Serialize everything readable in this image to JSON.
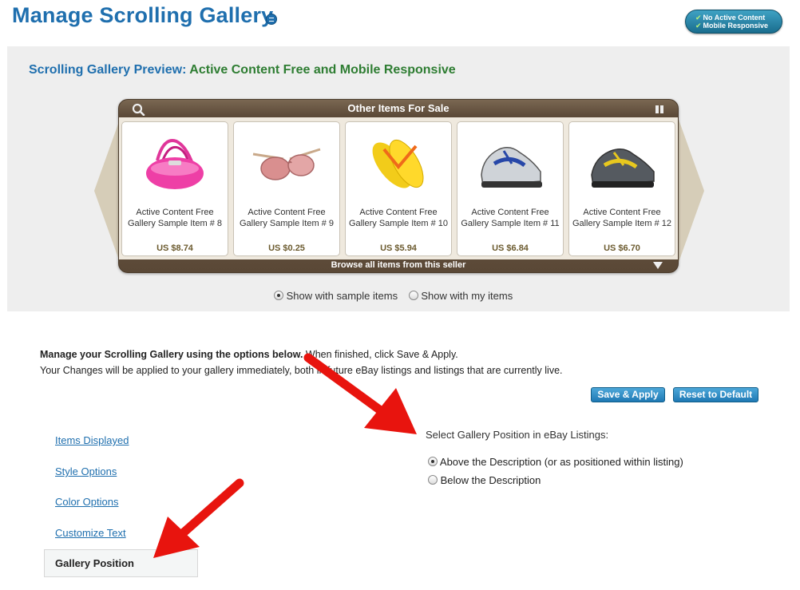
{
  "header": {
    "title": "Manage Scrolling Gallery",
    "badge_line1": "No Active Content",
    "badge_line2": "Mobile Responsive"
  },
  "preview": {
    "label": "Scrolling Gallery Preview:",
    "label_highlight": "Active Content Free and Mobile Responsive",
    "gallery_title": "Other Items For Sale",
    "gallery_footer": "Browse all items from this seller",
    "items": [
      {
        "line1": "Active Content Free",
        "line2": "Gallery Sample Item # 8",
        "price": "US $8.74",
        "image": "pink-handbag"
      },
      {
        "line1": "Active Content Free",
        "line2": "Gallery Sample Item # 9",
        "price": "US $0.25",
        "image": "sunglasses"
      },
      {
        "line1": "Active Content Free",
        "line2": "Gallery Sample Item # 10",
        "price": "US $5.94",
        "image": "flip-flops"
      },
      {
        "line1": "Active Content Free",
        "line2": "Gallery Sample Item # 11",
        "price": "US $6.84",
        "image": "running-shoe-blue"
      },
      {
        "line1": "Active Content Free",
        "line2": "Gallery Sample Item # 12",
        "price": "US $6.70",
        "image": "running-shoe-yellow"
      }
    ],
    "radio_sample": "Show with sample items",
    "radio_my_items": "Show with my items",
    "radio_selected": "sample"
  },
  "instructions": {
    "bold": "Manage your Scrolling Gallery using the options below.",
    "rest_line1": " When finished, click Save & Apply.",
    "line2": "Your Changes will be applied to your gallery immediately, both in future eBay listings and listings that are currently live."
  },
  "buttons": {
    "save": "Save & Apply",
    "reset": "Reset to Default"
  },
  "nav": {
    "items_displayed": "Items Displayed",
    "style_options": "Style Options",
    "color_options": "Color Options",
    "customize_text": "Customize Text",
    "gallery_position": "Gallery Position"
  },
  "position": {
    "heading": "Select Gallery Position in eBay Listings:",
    "option_above": "Above the Description (or as positioned within listing)",
    "option_below": "Below the Description",
    "selected": "above"
  },
  "colors": {
    "accent_blue": "#1f6fae",
    "highlight_green": "#2e7d32",
    "annotation_red": "#e8140e"
  }
}
